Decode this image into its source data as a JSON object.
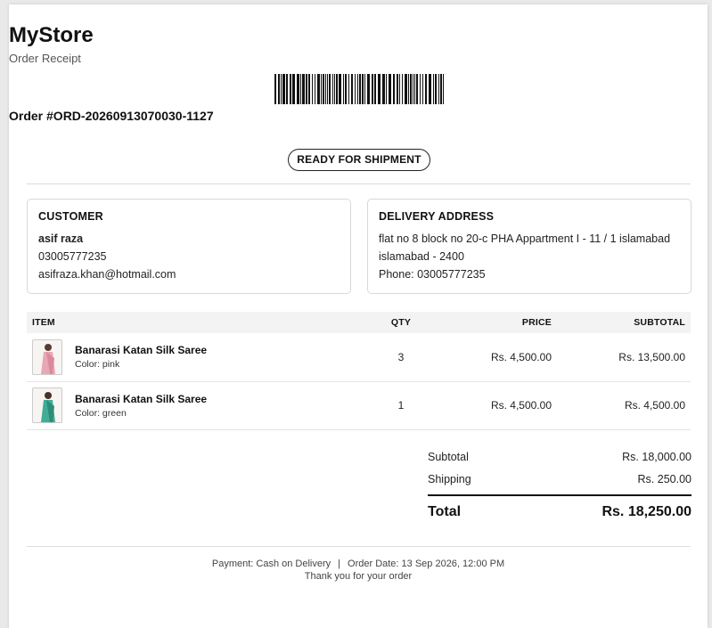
{
  "store": {
    "name": "MyStore",
    "subtitle": "Order Receipt",
    "order_number": "Order #ORD-20260913070030-1127",
    "status": "READY FOR SHIPMENT"
  },
  "customer": {
    "title": "CUSTOMER",
    "name": "asif raza",
    "phone": "03005777235",
    "email": "asifraza.khan@hotmail.com"
  },
  "delivery": {
    "title": "DELIVERY ADDRESS",
    "address_line1": "flat no 8 block no 20-c PHA Appartment I - 11 / 1 islamabad",
    "address_line2": "islamabad - 2400",
    "phone": "Phone: 03005777235"
  },
  "table": {
    "headers": {
      "item": "ITEM",
      "qty": "QTY",
      "price": "PRICE",
      "subtotal": "SUBTOTAL"
    },
    "rows": [
      {
        "name": "Banarasi Katan Silk Saree",
        "color": "Color: pink",
        "qty": "3",
        "price": "Rs. 4,500.00",
        "subtotal": "Rs. 13,500.00",
        "thumb_color": "#e8a7b4"
      },
      {
        "name": "Banarasi Katan Silk Saree",
        "color": "Color: green",
        "qty": "1",
        "price": "Rs. 4,500.00",
        "subtotal": "Rs. 4,500.00",
        "thumb_color": "#3fae95"
      }
    ]
  },
  "totals": {
    "subtotal_label": "Subtotal",
    "subtotal_value": "Rs. 18,000.00",
    "shipping_label": "Shipping",
    "shipping_value": "Rs. 250.00",
    "total_label": "Total",
    "total_value": "Rs. 18,250.00"
  },
  "footer": {
    "payment": "Payment: Cash on Delivery",
    "separator": "|",
    "order_date": "Order Date: 13 Sep 2026, 12:00 PM",
    "thanks": "Thank you for your order"
  }
}
